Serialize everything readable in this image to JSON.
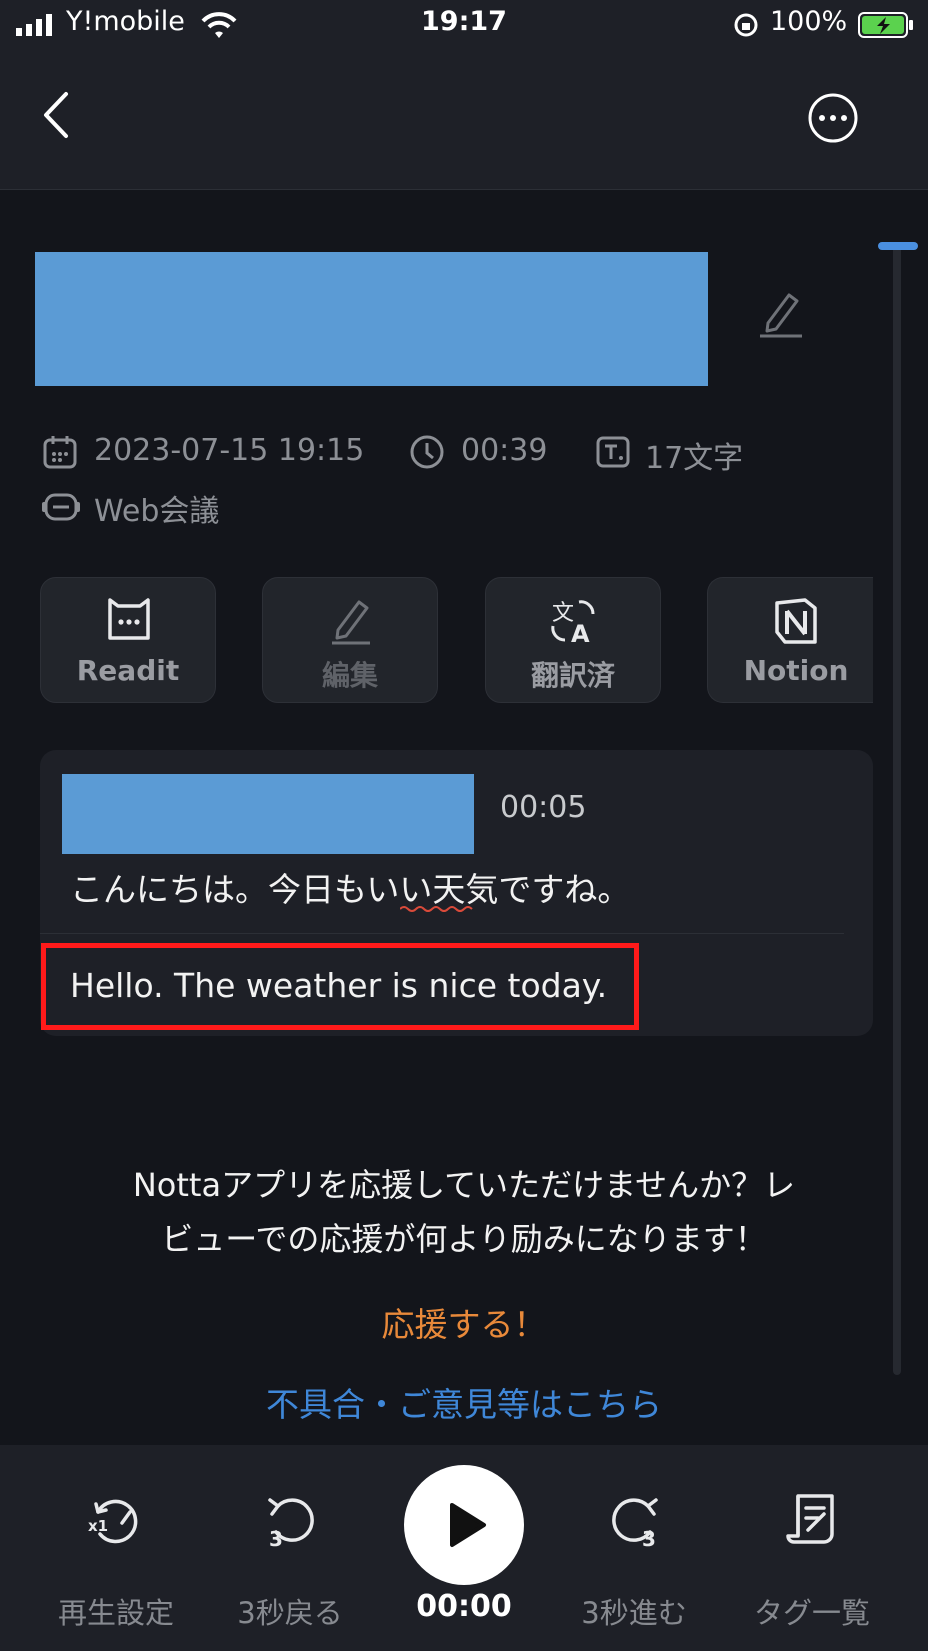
{
  "status_bar": {
    "carrier": "Y!mobile",
    "time": "19:17",
    "battery": "100%"
  },
  "nav": {
    "back_icon": "chevron-left-icon",
    "more_icon": "more-horizontal-icon"
  },
  "meta": {
    "datetime": "2023-07-15 19:15",
    "duration": "00:39",
    "char_count": "17文字",
    "category": "Web会議"
  },
  "actions": [
    {
      "label": "Readit",
      "icon": "readit-icon"
    },
    {
      "label": "編集",
      "icon": "pencil-icon"
    },
    {
      "label": "翻訳済",
      "icon": "translate-icon"
    },
    {
      "label": "Notion",
      "icon": "notion-icon"
    }
  ],
  "transcript": {
    "timestamp": "00:05",
    "text": "こんにちは。今日もいい天気ですね。",
    "translation": "Hello. The weather is nice today."
  },
  "review": {
    "line1": "Nottaアプリを応援していただけませんか？レ",
    "line2": "ビューでの応援が何より励みになります！",
    "cheer_link": "応援する！",
    "feedback_link": "不具合・ご意見等はこちら"
  },
  "player": {
    "speed_label": "再生設定",
    "back_label": "3秒戻る",
    "time": "00:00",
    "forward_label": "3秒進む",
    "tags_label": "タグ一覧"
  },
  "colors": {
    "accent_orange": "#e8893a",
    "link_blue": "#3f87d8",
    "highlight_red": "#ff1a1a",
    "redaction_blue": "#5b9bd5"
  }
}
